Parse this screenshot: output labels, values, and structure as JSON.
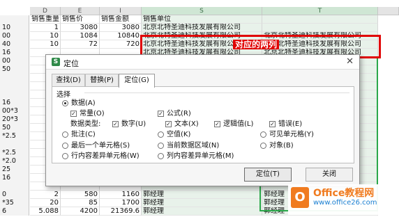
{
  "sheet": {
    "col_headers": [
      "D",
      "E",
      "I",
      "S",
      "T"
    ],
    "header_row": {
      "d": "销售重量",
      "e": "销售价",
      "i": "销售金额",
      "s": "销售单位"
    },
    "rows": [
      {
        "r": "10",
        "d": "1",
        "e": "3080",
        "i": "3080",
        "s": "北京北特圣迪科技发展有限公司",
        "t": ""
      },
      {
        "r": "00",
        "d": "10",
        "e": "1084",
        "i": "10840",
        "s": "北京北特圣迪科技发展有限公司",
        "t": "北京北特圣迪科技发展有限公司"
      },
      {
        "r": "40",
        "d": "10",
        "e": "72",
        "i": "720",
        "s": "北京北特圣迪科技发展有限公司",
        "t": "北京北特圣迪科技发展有限公司"
      },
      {
        "r": "16",
        "d": "",
        "e": "",
        "i": "",
        "s": "北京北特圣迪科技发展有限公司",
        "t": "北京北特圣迪科技发展有限公司"
      },
      {
        "r": "00",
        "d": "",
        "e": "",
        "i": "",
        "s": "",
        "t": "限公司"
      },
      {
        "r": "50",
        "d": "",
        "e": "",
        "i": "",
        "s": "",
        "t": "限公司"
      },
      {
        "r": "",
        "d": "",
        "e": "",
        "i": "",
        "s": "",
        "t": "限公司"
      },
      {
        "r": "",
        "d": "",
        "e": "",
        "i": "",
        "s": "",
        "t": "限公司"
      },
      {
        "r": "",
        "d": "",
        "e": "",
        "i": "",
        "s": "",
        "t": "限公司"
      },
      {
        "r": "16",
        "d": "",
        "e": "",
        "i": "",
        "s": "",
        "t": ""
      },
      {
        "r": "00*3",
        "d": "",
        "e": "",
        "i": "",
        "s": "",
        "t": ""
      },
      {
        "r": "20*3",
        "d": "",
        "e": "",
        "i": "",
        "s": "",
        "t": ""
      },
      {
        "r": "50",
        "d": "",
        "e": "",
        "i": "",
        "s": "",
        "t": ""
      },
      {
        "r": "*2.5",
        "d": "",
        "e": "",
        "i": "",
        "s": "",
        "t": ""
      },
      {
        "r": "",
        "d": "",
        "e": "",
        "i": "",
        "s": "",
        "t": ""
      },
      {
        "r": "*2.5",
        "d": "",
        "e": "",
        "i": "",
        "s": "",
        "t": ""
      },
      {
        "r": "*2.0",
        "d": "",
        "e": "",
        "i": "",
        "s": "",
        "t": ""
      },
      {
        "r": "25",
        "d": "",
        "e": "",
        "i": "",
        "s": "",
        "t": ""
      },
      {
        "r": "16",
        "d": "",
        "e": "",
        "i": "",
        "s": "",
        "t": ""
      },
      {
        "r": "",
        "d": "",
        "e": "",
        "i": "",
        "s": "",
        "t": ""
      },
      {
        "r": "0",
        "d": "2",
        "e": "580",
        "i": "1160",
        "s": "郭经理",
        "t": "郭经理"
      },
      {
        "r": "*35",
        "d": "20",
        "e": "85",
        "i": "1700",
        "s": "郭经理",
        "t": "郭经理"
      },
      {
        "r": "6",
        "d": "5.088",
        "e": "4200",
        "i": "21369.6",
        "s": "郭经理",
        "t": "郭经理"
      }
    ],
    "annotation": "对应的两列"
  },
  "dialog": {
    "title": "定位",
    "tabs": [
      {
        "label": "查找(D)",
        "active": false
      },
      {
        "label": "替换(P)",
        "active": false
      },
      {
        "label": "定位(G)",
        "active": true
      }
    ],
    "section_label": "选择",
    "data_option": "数据(A)",
    "constants": "常量(O)",
    "formulas": "公式(R)",
    "data_types_label": "数据类型:",
    "types": [
      "数字(U)",
      "文本(X)",
      "逻辑值(L)",
      "错误(E)"
    ],
    "options_row1": [
      "批注(C)",
      "空值(K)",
      "可见单元格(Y)"
    ],
    "options_row2": [
      "最后一个单元格(S)",
      "当前数据区域(N)",
      "对象(B)"
    ],
    "options_row3": [
      "行内容差异单元格(W)",
      "列内容差异单元格(M)"
    ],
    "locate_button": "定位(T)",
    "close_button": "关闭"
  },
  "watermark": {
    "brand": "Office教程网",
    "url": "www.office26.com"
  }
}
